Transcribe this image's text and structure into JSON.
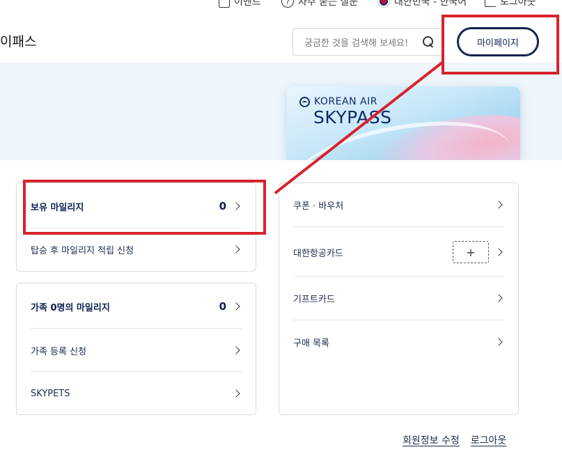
{
  "topbar": {
    "events": "이벤트",
    "faq": "자주 묻는 질문",
    "region": "대한민국 - 한국어",
    "logout": "로그아웃"
  },
  "header": {
    "title": "이패스",
    "search_placeholder": "궁금한 것을 검색해 보세요!",
    "mypage_label": "마이페이지"
  },
  "card": {
    "brand": "KOREAN AIR",
    "product": "SKYPASS"
  },
  "left_panel_1": {
    "mileage_label": "보유 마일리지",
    "mileage_value": "0",
    "retro_claim_label": "탑승 후 마일리지 적립 신청"
  },
  "left_panel_2": {
    "family_label": "가족 0명의 마일리지",
    "family_value": "0",
    "family_register_label": "가족 등록 신청",
    "skypets_label": "SKYPETS"
  },
  "right_panel": {
    "coupon_label": "쿠폰 · 바우처",
    "card_label": "대한항공카드",
    "add_symbol": "+",
    "giftcard_label": "기프트카드",
    "purchase_label": "구매 목록"
  },
  "footer": {
    "edit_profile": "회원정보 수정",
    "logout": "로그아웃"
  },
  "colors": {
    "brand_navy": "#0b1f4f",
    "annotation_red": "#d7232e",
    "hero_bg": "#eef5fb"
  }
}
